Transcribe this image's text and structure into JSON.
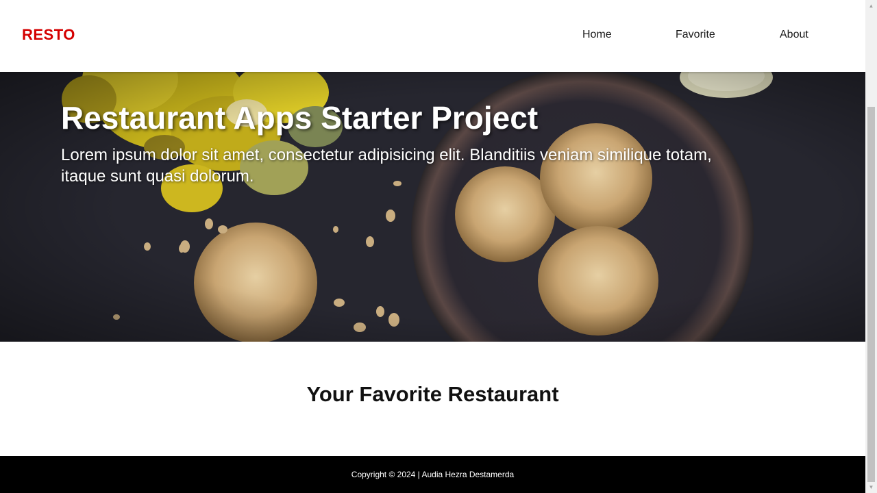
{
  "header": {
    "brand": "RESTO",
    "nav": [
      {
        "label": "Home"
      },
      {
        "label": "Favorite"
      },
      {
        "label": "About"
      }
    ]
  },
  "hero": {
    "title": "Restaurant Apps Starter Project",
    "text": "Lorem ipsum dolor sit amet, consectetur adipisicing elit. Blanditiis veniam similique totam, itaque sunt quasi dolorum."
  },
  "main": {
    "title": "Your Favorite Restaurant"
  },
  "footer": {
    "copyright": "Copyright © 2024 | Audia Hezra Destamerda"
  },
  "colors": {
    "brand": "#d40000",
    "footer_bg": "#000000",
    "hero_bg": "#23242c"
  }
}
